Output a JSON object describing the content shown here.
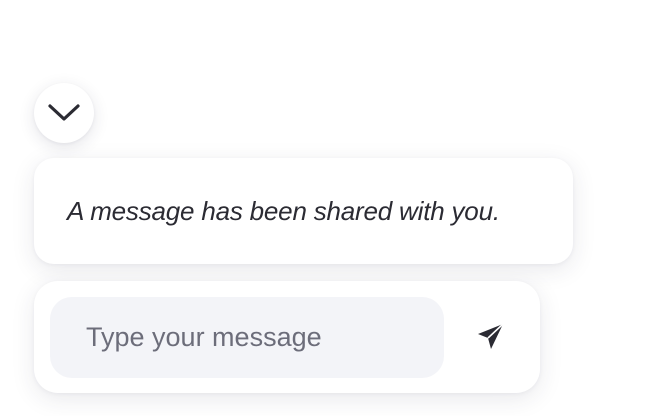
{
  "chat": {
    "collapse_icon": "chevron-down-icon",
    "message": "A message has been shared with you.",
    "input": {
      "placeholder": "Type your message",
      "value": ""
    },
    "send_icon": "send-icon"
  },
  "colors": {
    "text": "#2b2b33",
    "placeholder": "#6c6d7a",
    "input_background": "#f3f4f8",
    "card_background": "#ffffff"
  }
}
